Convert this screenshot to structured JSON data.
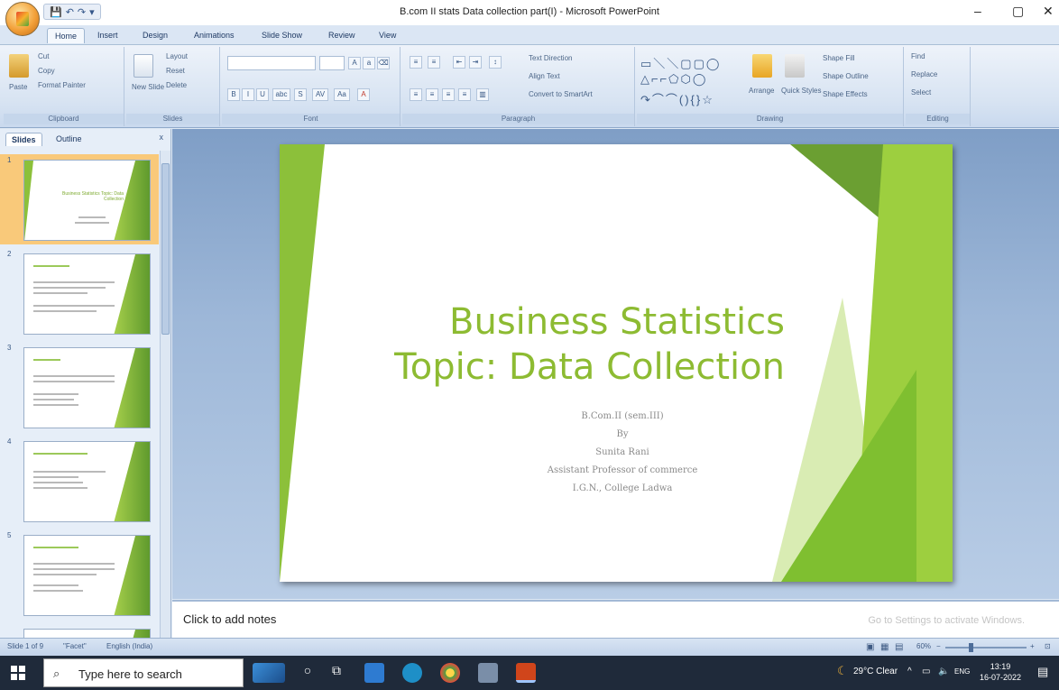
{
  "window": {
    "title": "B.com II stats Data collection part(I) - Microsoft PowerPoint",
    "minimize": "–",
    "maximize": "▢",
    "close": "✕"
  },
  "ribbon": {
    "tabs": [
      "Home",
      "Insert",
      "Design",
      "Animations",
      "Slide Show",
      "Review",
      "View"
    ],
    "clipboard": {
      "paste": "Paste",
      "cut": "Cut",
      "copy": "Copy",
      "format_painter": "Format Painter",
      "label": "Clipboard"
    },
    "slides": {
      "new_slide": "New Slide",
      "layout": "Layout",
      "reset": "Reset",
      "delete": "Delete",
      "label": "Slides"
    },
    "font": {
      "label": "Font",
      "bold": "B",
      "italic": "I",
      "underline": "U",
      "strike": "abc",
      "shadow": "S",
      "spacing": "AV",
      "case": "Aa",
      "color": "A"
    },
    "paragraph": {
      "text_direction": "Text Direction",
      "align_text": "Align Text",
      "convert_smartart": "Convert to SmartArt",
      "label": "Paragraph"
    },
    "drawing": {
      "arrange": "Arrange",
      "quick_styles": "Quick Styles",
      "shape_fill": "Shape Fill",
      "shape_outline": "Shape Outline",
      "shape_effects": "Shape Effects",
      "label": "Drawing"
    },
    "editing": {
      "find": "Find",
      "replace": "Replace",
      "select": "Select",
      "label": "Editing"
    }
  },
  "panel": {
    "tabs": [
      "Slides",
      "Outline"
    ],
    "close": "x",
    "slide_numbers": [
      "1",
      "2",
      "3",
      "4",
      "5"
    ],
    "thumb1_title": "Business Statistics Topic: Data Collection"
  },
  "slide": {
    "title_line1": "Business Statistics",
    "title_line2": "Topic: Data Collection",
    "sub1": "B.Com.II (sem.III)",
    "sub2": "By",
    "sub3": "Sunita Rani",
    "sub4": "Assistant Professor of commerce",
    "sub5": "I.G.N., College Ladwa"
  },
  "notes": {
    "placeholder": "Click to add notes",
    "watermark": "Go to Settings to activate Windows."
  },
  "status": {
    "slide_of": "Slide 1 of 9",
    "theme": "\"Facet\"",
    "language": "English (India)",
    "zoom": "60%"
  },
  "taskbar": {
    "search_placeholder": "Type here to search",
    "weather": "29°C Clear",
    "lang": "ENG",
    "time": "13:19",
    "date": "16-07-2022"
  }
}
